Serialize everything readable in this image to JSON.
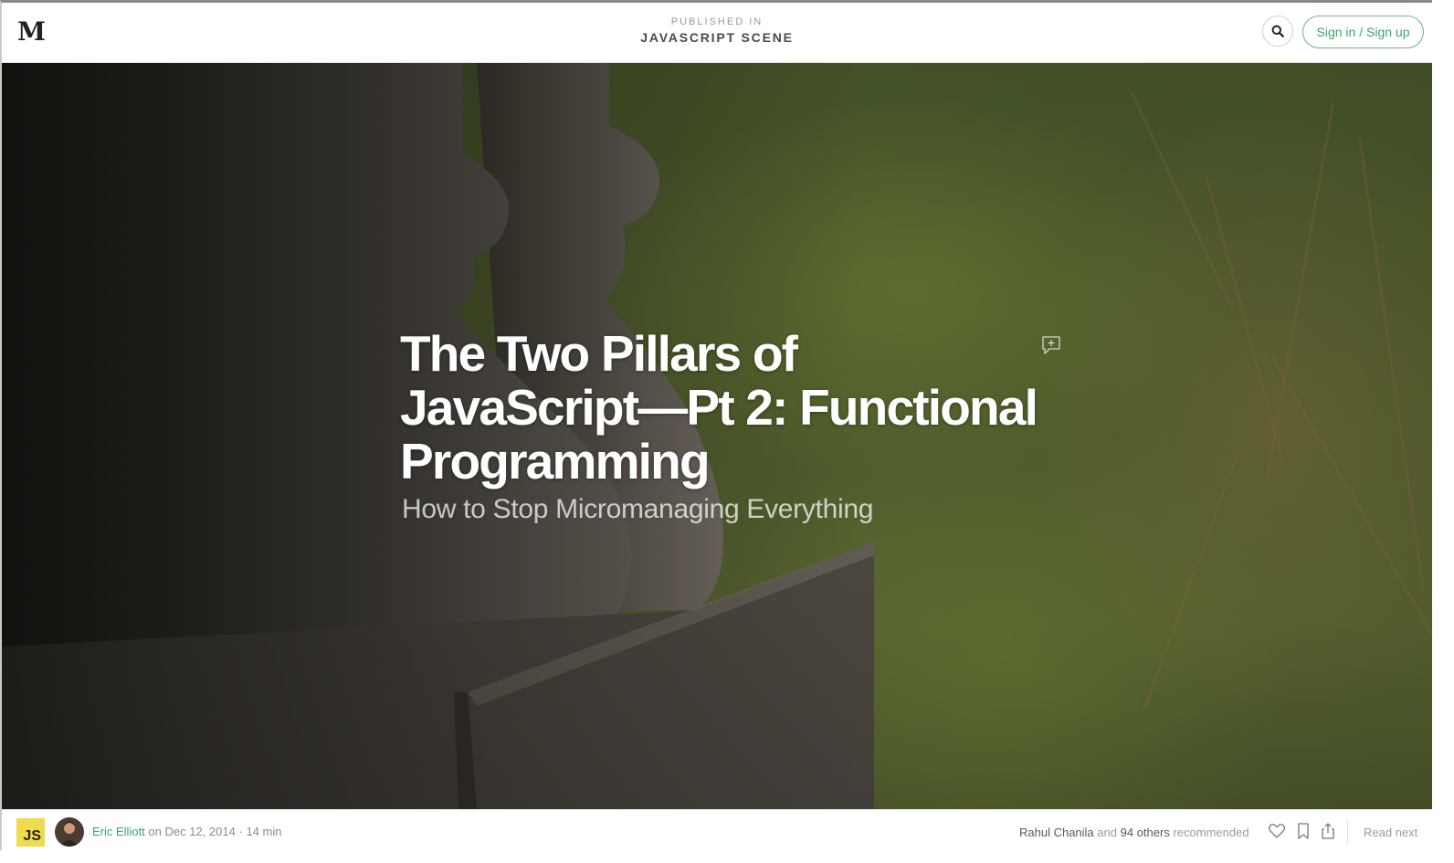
{
  "header": {
    "logo": "M",
    "published_in_label": "PUBLISHED IN",
    "publication_name": "JAVASCRIPT SCENE",
    "signin_label": "Sign in / Sign up"
  },
  "hero": {
    "title": "The Two Pillars of JavaScript—Pt 2: Functional Programming",
    "subtitle": "How to Stop Micromanaging Everything"
  },
  "footer": {
    "publication_badge": "JS",
    "author": "Eric Elliott",
    "date_prefix": "on",
    "date": "Dec 12, 2014",
    "separator": "·",
    "read_time": "14 min",
    "recommender": "Rahul Chanila",
    "and_label": "and",
    "others_count": "94 others",
    "recommended_label": "recommended",
    "read_next_label": "Read next"
  },
  "icons": [
    "medium-logo-icon",
    "search-icon",
    "add-comment-icon",
    "heart-icon",
    "bookmark-icon",
    "share-icon"
  ],
  "colors": {
    "accent": "#3aa568",
    "js_badge": "#f0db4f"
  }
}
